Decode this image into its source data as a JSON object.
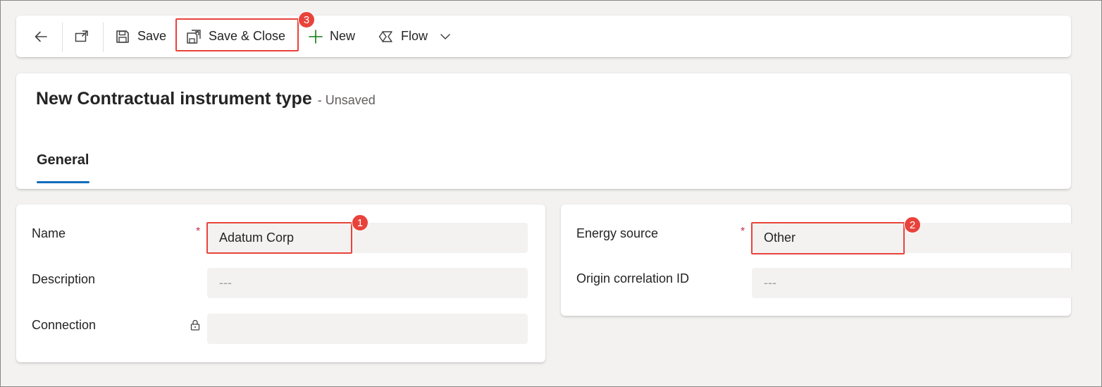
{
  "toolbar": {
    "save_label": "Save",
    "save_close_label": "Save & Close",
    "new_label": "New",
    "flow_label": "Flow",
    "callout_number": "3"
  },
  "header": {
    "title": "New Contractual instrument type",
    "status": "- Unsaved",
    "tab_general": "General"
  },
  "left_section": {
    "name_label": "Name",
    "name_required": "*",
    "name_value": "Adatum Corp",
    "name_callout": "1",
    "description_label": "Description",
    "description_value": "---",
    "connection_label": "Connection",
    "connection_value": ""
  },
  "right_section": {
    "energy_source_label": "Energy source",
    "energy_source_required": "*",
    "energy_source_value": "Other",
    "energy_source_callout": "2",
    "origin_label": "Origin correlation ID",
    "origin_value": "---"
  },
  "colors": {
    "accent": "#0f6cbd",
    "callout": "#e8433b",
    "required": "#c4314b",
    "new_plus": "#107c10"
  }
}
